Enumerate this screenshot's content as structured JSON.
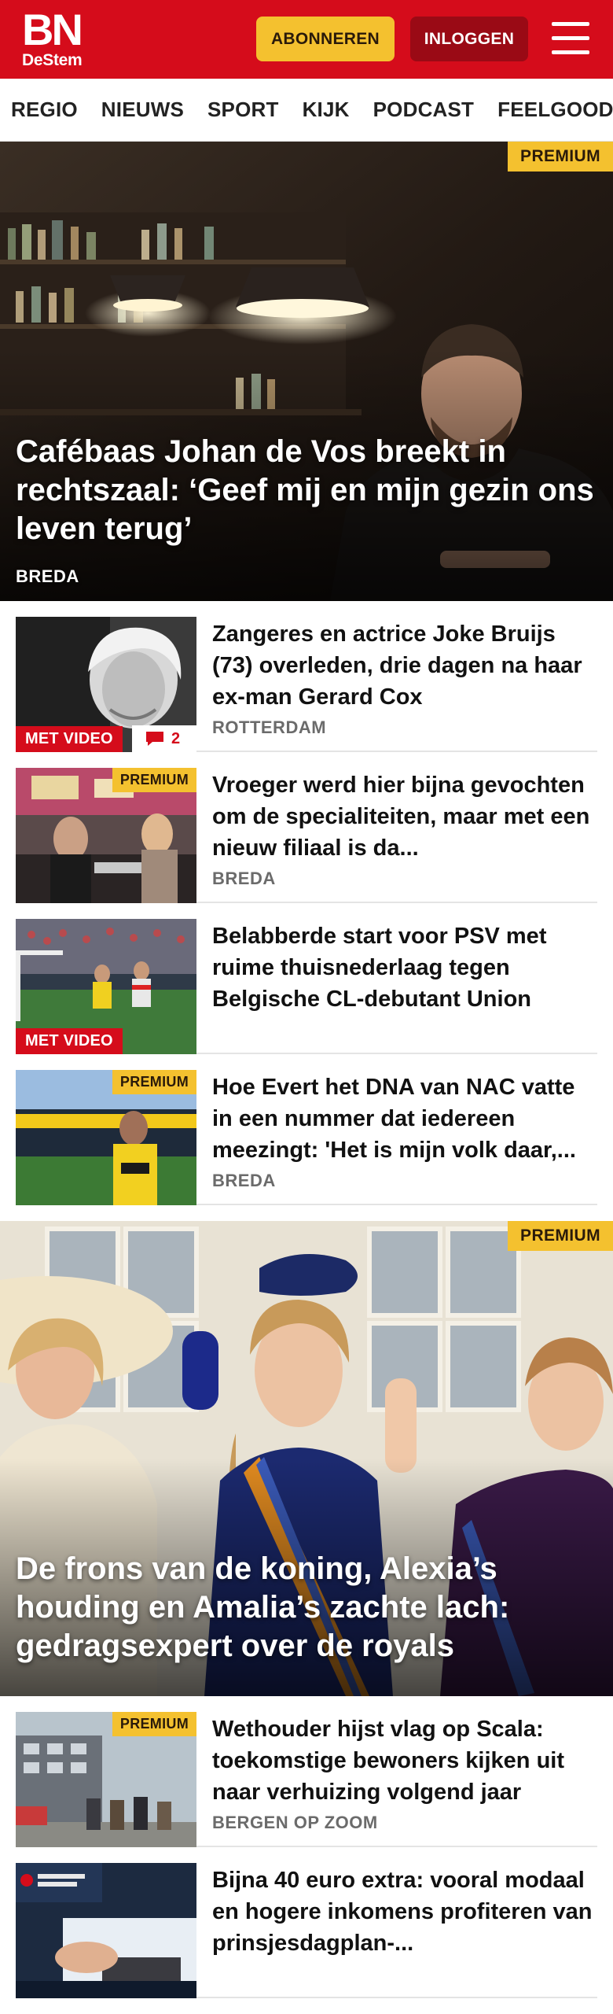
{
  "header": {
    "logo_main": "BN",
    "logo_sub": "DeStem",
    "subscribe_label": "ABONNEREN",
    "login_label": "INLOGGEN",
    "menu_icon": "hamburger-icon",
    "brand_color": "#d50c1b"
  },
  "nav": {
    "items": [
      "REGIO",
      "NIEUWS",
      "SPORT",
      "KIJK",
      "PODCAST",
      "FEELGOOD"
    ]
  },
  "hero1": {
    "badge": "PREMIUM",
    "title": "Cafébaas Johan de Vos breekt in rechtszaal: ‘Geef mij en mijn gezin ons leven terug’",
    "location": "BREDA"
  },
  "articles": [
    {
      "title": "Zangeres en actrice Joke Bruijs (73) overleden, drie dagen na haar ex-man Gerard Cox",
      "location": "ROTTERDAM",
      "video_label": "MET VIDEO",
      "comments": "2"
    },
    {
      "title": "Vroeger werd hier bijna gevochten om de specialiteiten, maar met een nieuw filiaal is da...",
      "location": "BREDA",
      "premium_label": "PREMIUM"
    },
    {
      "title": "Belabberde start voor PSV met ruime thuisnederlaag tegen Belgische CL-debutant Union",
      "video_label": "MET VIDEO"
    },
    {
      "title": "Hoe Evert het DNA van NAC vatte in een nummer dat iedereen meezingt: 'Het is mijn volk daar,...",
      "location": "BREDA",
      "premium_label": "PREMIUM"
    }
  ],
  "hero2": {
    "badge": "PREMIUM",
    "title": "De frons van de koning, Alexia’s houding en Amalia’s zachte lach: gedragsexpert over de royals"
  },
  "articles2": [
    {
      "title": "Wethouder hijst vlag op Scala: toekomstige bewoners kijken uit naar verhuizing volgend jaar",
      "location": "BERGEN OP ZOOM",
      "premium_label": "PREMIUM"
    },
    {
      "title": "Bijna 40 euro extra: vooral modaal en hogere inkomens profiteren van prinsjesdagplan-..."
    }
  ]
}
